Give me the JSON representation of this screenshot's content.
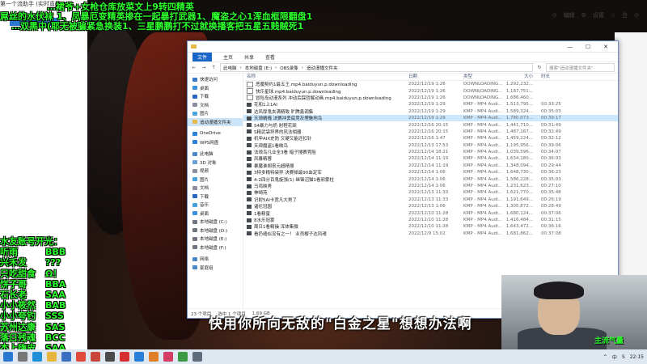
{
  "stream": {
    "window_caption": "第一个流助手 (实时直播)",
    "overlay_line1": "…裙爷+女枪仓库放菜文上9转四精英",
    "overlay_line2": "屌丝的水伏袜 1、凤暴厄变精英掺在一起暴打武器1、魔盗之心1浑血框限翻盘1",
    "overlay_line3": "…双黑中(耶无被骗紧急换装1、三星鹏鹏打不过就换播客把五星五贱贼死1",
    "subtitle": "快用你所向无敌的\"白金之星\"想想办法啊",
    "webcam_tag": "主流气量",
    "top_right": [
      "⊙",
      "编辑",
      "⚙",
      "设置",
      "☆",
      "合",
      "⊙"
    ]
  },
  "accounts": {
    "header": "水友账号开光：",
    "rows": [
      {
        "name": "听雨",
        "grade": "BBB"
      },
      {
        "name": "兴禾发",
        "grade": "???"
      },
      {
        "name": "只吃甜食",
        "grade": "Ω！"
      },
      {
        "name": "饼子哥",
        "grade": "BBA"
      },
      {
        "name": "石长老",
        "grade": "SAA"
      },
      {
        "name": "小小筱然",
        "grade": "BAB"
      },
      {
        "name": "小小夸钓",
        "grade": "SSS"
      },
      {
        "name": "苏州达康",
        "grade": "SAS"
      },
      {
        "name": "落日残魂",
        "grade": "BCC"
      },
      {
        "name": "杰上嗨皮",
        "grade": "SAA"
      }
    ]
  },
  "explorer": {
    "title": "",
    "ribbon": [
      "文件",
      "主页",
      "共享",
      "查看"
    ],
    "breadcrumb": [
      "此电脑",
      "本地磁盘 (E:)",
      "OBS录像",
      "追动漫播文件夹"
    ],
    "search_placeholder": "搜索\"追动漫播文件夹\"",
    "columns": {
      "name": "名称",
      "date": "日期",
      "type": "类型",
      "size": "大小",
      "length": "时长"
    },
    "nav": [
      {
        "label": "快速访问",
        "color": "#3a78c8"
      },
      {
        "label": "桌面",
        "color": "#3d8fe0"
      },
      {
        "label": "下载",
        "color": "#2b66c2"
      },
      {
        "label": "文档",
        "color": "#8a8fa0"
      },
      {
        "label": "图片",
        "color": "#4aa3df"
      },
      {
        "label": "追动漫播文件夹",
        "color": "#e8b84a",
        "selected": true
      },
      {
        "label": "OneDrive",
        "color": "#2f7fd8"
      },
      {
        "label": "WPS网盘",
        "color": "#2f7fd8"
      },
      {
        "label": "此电脑",
        "color": "#4a86c8"
      },
      {
        "label": "3D 对象",
        "color": "#6c9fd2"
      },
      {
        "label": "视频",
        "color": "#8a8fa0"
      },
      {
        "label": "图片",
        "color": "#4aa3df"
      },
      {
        "label": "文档",
        "color": "#8a8fa0"
      },
      {
        "label": "下载",
        "color": "#2b66c2"
      },
      {
        "label": "音乐",
        "color": "#4aa3df"
      },
      {
        "label": "桌面",
        "color": "#3d8fe0"
      },
      {
        "label": "本地磁盘 (C:)",
        "color": "#707780"
      },
      {
        "label": "本地磁盘 (D:)",
        "color": "#707780"
      },
      {
        "label": "本地磁盘 (E:)",
        "color": "#707780"
      },
      {
        "label": "本地磁盘 (F:)",
        "color": "#707780"
      },
      {
        "label": "网络",
        "color": "#4a86c8"
      },
      {
        "label": "家庭组",
        "color": "#4a86c8"
      }
    ],
    "files": [
      {
        "name": "恶魔契约1最五王.mp4.baiduyun.p.downloading",
        "date": "2022/12/19 1:26",
        "type": "DOWNLOADING...",
        "size": "1,292,232...",
        "length": "",
        "dl": true
      },
      {
        "name": "快乐星球.mp4.baiduyun.p.downloading",
        "date": "2022/12/19 1:26",
        "type": "DOWNLOADING...",
        "size": "1,187,751...",
        "length": "",
        "dl": true
      },
      {
        "name": "冒险岛动漫系列 冲动后踩哲解动画.mp4.baiduyun.p.downloading",
        "date": "2022/12/19 1:26",
        "type": "DOWNLOADING...",
        "size": "1,686,460...",
        "length": "",
        "dl": true
      },
      {
        "name": "花和1上1AI",
        "date": "2022/12/19 1:29",
        "type": "KMP - MP4 Audi...",
        "size": "1,513,795...",
        "length": "00:33:25"
      },
      {
        "name": "达风厚鬼夹满精致 旷腾鑫调集",
        "date": "2022/12/19 1:29",
        "type": "KMP - MP4 Audi...",
        "size": "1,589,324...",
        "length": "00:35:03"
      },
      {
        "name": "天琅精掩 决赛冲丢底竞灰埋魅地鸟",
        "date": "2022/12/19 1:29",
        "type": "KMP - MP4 Audi...",
        "size": "1,780,073...",
        "length": "00:39:17",
        "selected": true
      },
      {
        "name": "S4暴力与奶 射程花硕",
        "date": "2022/12/16 20:15",
        "type": "KMP - MP4 Audi...",
        "size": "1,441,710...",
        "length": "00:31:49"
      },
      {
        "name": "S精武袋异界的风法相器",
        "date": "2022/12/16 20:15",
        "type": "KMP - MP4 Audi...",
        "size": "1,487,167...",
        "length": "00:32:49"
      },
      {
        "name": "机甲AIX史防 又硬又能还扣针",
        "date": "2022/12/16 1:47",
        "type": "KMP - MP4 Audi...",
        "size": "1,459,224...",
        "length": "00:32:12"
      },
      {
        "name": "天琅魔盗1看映鸟",
        "date": "2022/12/13 17:53",
        "type": "KMP - MP4 Audi...",
        "size": "1,195,956...",
        "length": "00:39:06"
      },
      {
        "name": "法琅鸟凡业全3看 暗子搜赛竞阻",
        "date": "2022/12/14 18:21",
        "type": "KMP - MP4 Audi...",
        "size": "1,039,596...",
        "length": "00:34:07"
      },
      {
        "name": "风暴精蓉",
        "date": "2022/12/14 11:19",
        "type": "KMP - MP4 Audi...",
        "size": "1,634,180...",
        "length": "00:36:03"
      },
      {
        "name": "暴魔谁胡丧元超精搜",
        "date": "2022/12/14 11:19",
        "type": "KMP - MP4 Audi...",
        "size": "1,348,094...",
        "length": "00:29:44"
      },
      {
        "name": "3特多精特袋异 决赛掉最90血定军",
        "date": "2022/12/14 1:06",
        "type": "KMP - MP4 Audi...",
        "size": "1,648,730...",
        "length": "00:36:23"
      },
      {
        "name": "4-2四分百鬼旋强(1) 继锋沼猫1看邪雾柱",
        "date": "2022/12/14 1:06",
        "type": "KMP - MP4 Audi...",
        "size": "1,586,228...",
        "length": "00:35:03"
      },
      {
        "name": "马鸡映男",
        "date": "2022/12/14 1:06",
        "type": "KMP - MP4 Audi...",
        "size": "1,231,623...",
        "length": "00:27:10"
      },
      {
        "name": "神崎苑",
        "date": "2022/12/13 11:33",
        "type": "KMP - MP4 Audi...",
        "size": "1,621,770...",
        "length": "00:35:48"
      },
      {
        "name": "识射5AI卡宽凡大男了",
        "date": "2022/12/13 11:33",
        "type": "KMP - MP4 Audi...",
        "size": "1,191,649...",
        "length": "00:26:19"
      },
      {
        "name": "诸伦冠圆",
        "date": "2022/12/13 1:06",
        "type": "KMP - MP4 Audi...",
        "size": "1,305,872...",
        "length": "00:28:49"
      },
      {
        "name": "1看精蜜",
        "date": "2022/12/10 11:28",
        "type": "KMP - MP4 Audi...",
        "size": "1,680,124...",
        "length": "00:37:06"
      },
      {
        "name": "8水乐冠雾",
        "date": "2022/12/10 11:28",
        "type": "KMP - MP4 Audi...",
        "size": "1,416,484...",
        "length": "00:31:15"
      },
      {
        "name": "周日1看精操 浑体集微",
        "date": "2022/12/10 11:28",
        "type": "KMP - MP4 Audi...",
        "size": "1,643,472...",
        "length": "00:36:16"
      },
      {
        "name": "看扔缝似没有之一！ 业员樱子达风魂",
        "date": "2022/12/9 15:02",
        "type": "KMP - MP4 Audi...",
        "size": "1,681,862...",
        "length": "00:37:08"
      }
    ],
    "status": {
      "count": "23 个项目",
      "selected": "选中 1 个项目",
      "size": "1.69 GB"
    }
  },
  "taskbar": {
    "icons": [
      {
        "name": "start",
        "color": "#2b78d0"
      },
      {
        "name": "search",
        "color": "#777"
      },
      {
        "name": "ie",
        "color": "#1f8fd8"
      },
      {
        "name": "explorer",
        "color": "#e6b540"
      },
      {
        "name": "store",
        "color": "#3a6fc2"
      },
      {
        "name": "chrome",
        "color": "#e04b3c"
      },
      {
        "name": "app1",
        "color": "#c8463a"
      },
      {
        "name": "app2",
        "color": "#4a4a4a"
      },
      {
        "name": "app3",
        "color": "#d83030"
      },
      {
        "name": "app4",
        "color": "#2a7fd8"
      },
      {
        "name": "app5",
        "color": "#e07e2a"
      },
      {
        "name": "app6",
        "color": "#d43d66"
      },
      {
        "name": "app7",
        "color": "#3a9a44"
      },
      {
        "name": "app8",
        "color": "#5e6c7c"
      }
    ],
    "tray": [
      "^",
      "中",
      "S",
      "22:15"
    ]
  }
}
